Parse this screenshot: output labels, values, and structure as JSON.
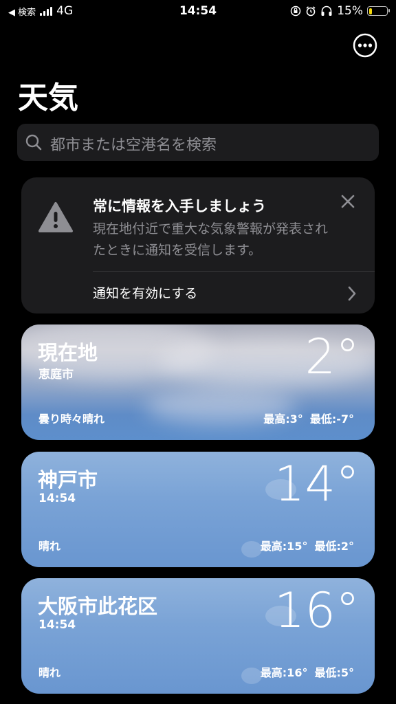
{
  "status_bar": {
    "back_label": "◀ 検索",
    "network": "4G",
    "time": "14:54",
    "battery": "15%",
    "battery_level": 0.15,
    "battery_color": "#f5d90a"
  },
  "header": {
    "title": "天気"
  },
  "search": {
    "placeholder": "都市または空港名を検索"
  },
  "alert": {
    "title": "常に情報を入手しましょう",
    "body": "現在地付近で重大な気象警報が発表されたときに通知を受信します。",
    "action_label": "通知を有効にする"
  },
  "locations": [
    {
      "name": "現在地",
      "subtitle": "恵庭市",
      "temp": "2°",
      "condition": "曇り時々晴れ",
      "high": "最高:3°",
      "low": "最低:-7°"
    },
    {
      "name": "神戸市",
      "subtitle": "14:54",
      "temp": "14°",
      "condition": "晴れ",
      "high": "最高:15°",
      "low": "最低:2°"
    },
    {
      "name": "大阪市此花区",
      "subtitle": "14:54",
      "temp": "16°",
      "condition": "晴れ",
      "high": "最高:16°",
      "low": "最低:5°"
    }
  ]
}
